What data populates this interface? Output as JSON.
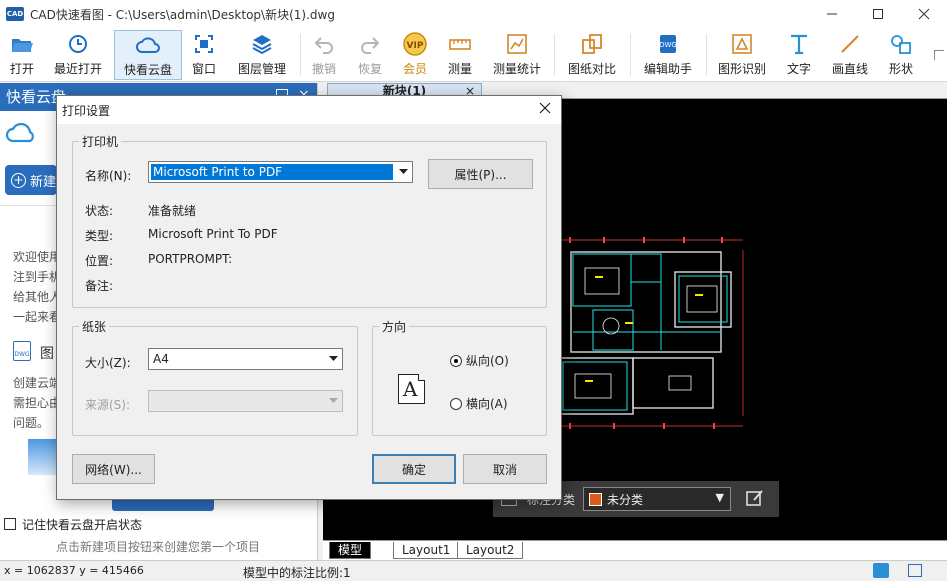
{
  "window": {
    "app_icon_text": "CAD",
    "title": "CAD快速看图 - C:\\Users\\admin\\Desktop\\新块(1).dwg",
    "controls": [
      "minimize-icon",
      "maximize-icon",
      "close-icon"
    ]
  },
  "toolbar": {
    "items": [
      {
        "label": "打开",
        "icon": "folder-open-icon",
        "enabled": true
      },
      {
        "label": "最近打开",
        "icon": "recent-clock-icon",
        "enabled": true
      },
      {
        "label": "快看云盘",
        "icon": "cloud-icon",
        "enabled": true,
        "selected": true
      },
      {
        "label": "窗口",
        "icon": "window-icon",
        "enabled": true
      },
      {
        "label": "图层管理",
        "icon": "layers-icon",
        "enabled": true
      },
      {
        "label": "撤销",
        "icon": "undo-icon",
        "enabled": false
      },
      {
        "label": "恢复",
        "icon": "redo-icon",
        "enabled": false
      },
      {
        "label": "会员",
        "icon": "vip-icon",
        "enabled": true
      },
      {
        "label": "测量",
        "icon": "ruler-icon",
        "enabled": true
      },
      {
        "label": "测量统计",
        "icon": "measure-stats-icon",
        "enabled": true
      },
      {
        "label": "图纸对比",
        "icon": "compare-icon",
        "enabled": true
      },
      {
        "label": "编辑助手",
        "icon": "edit-assistant-icon",
        "enabled": true
      },
      {
        "label": "图形识别",
        "icon": "shape-recognize-icon",
        "enabled": true
      },
      {
        "label": "文字",
        "icon": "text-icon",
        "enabled": true
      },
      {
        "label": "画直线",
        "icon": "line-icon",
        "enabled": true
      },
      {
        "label": "形状",
        "icon": "shape-icon",
        "enabled": true
      }
    ],
    "accent": "#1f6fc5"
  },
  "left_panel": {
    "title": "快看云盘",
    "new_button_label": "新建",
    "welcome_lines": [
      "欢迎使用",
      "注到手机",
      "给其他人",
      "一起来看"
    ],
    "section_title": "图",
    "section_lines": [
      "创建云端",
      "需担心由",
      "问题。"
    ],
    "remember_checkbox_label": "记住快看云盘开启状态",
    "hint": "点击新建项目按钮来创建您第一个项目"
  },
  "canvas": {
    "doc_tab": "新块(1)",
    "layout_tabs": [
      "模型",
      "Layout1",
      "Layout2"
    ],
    "active_layout": "模型",
    "annotation": {
      "label": "标注分类",
      "value": "未分类",
      "swatch_color": "#e05a1a"
    }
  },
  "status": {
    "coords": "x = 1062837  y = 415466",
    "scale": "模型中的标注比例:1"
  },
  "dialog": {
    "title": "打印设置",
    "printer": {
      "group": "打印机",
      "name_label": "名称(N):",
      "name_value": "Microsoft Print to PDF",
      "properties_button": "属性(P)...",
      "status_label": "状态:",
      "status_value": "准备就绪",
      "type_label": "类型:",
      "type_value": "Microsoft Print To PDF",
      "location_label": "位置:",
      "location_value": "PORTPROMPT:",
      "comment_label": "备注:",
      "comment_value": ""
    },
    "paper": {
      "group": "纸张",
      "size_label": "大小(Z):",
      "size_value": "A4",
      "source_label": "来源(S):",
      "source_value": ""
    },
    "orientation": {
      "group": "方向",
      "portrait_label": "纵向(O)",
      "landscape_label": "横向(A)",
      "selected": "portrait",
      "icon_letter": "A"
    },
    "buttons": {
      "network": "网络(W)...",
      "ok": "确定",
      "cancel": "取消"
    }
  }
}
